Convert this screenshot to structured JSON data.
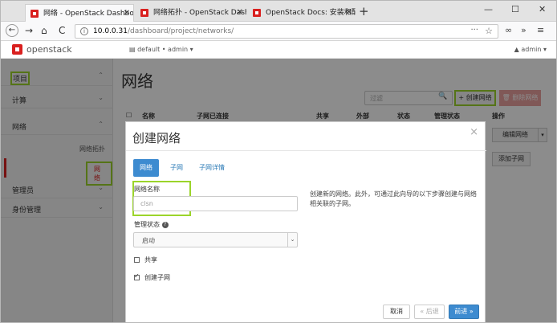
{
  "browser": {
    "tabs": [
      {
        "title": "网络 - OpenStack Dashboard",
        "active": true
      },
      {
        "title": "网络拓扑 - OpenStack Dashb",
        "active": false
      },
      {
        "title": "OpenStack Docs: 安装和配置",
        "active": false
      }
    ],
    "close_glyph": "✕",
    "new_tab_glyph": "+",
    "window_controls": {
      "minimize": "—",
      "maximize": "☐",
      "close": "✕"
    },
    "nav": {
      "back": "←",
      "forward": "→",
      "home": "⌂",
      "reload": "C"
    },
    "url_host": "10.0.0.31",
    "url_path": "/dashboard/project/networks/",
    "url_dots": "···",
    "bookmark_glyph": "☆",
    "toolbar_right": {
      "ext": "∞",
      "more": "»",
      "menu": "≡"
    }
  },
  "header": {
    "brand": "openstack",
    "project_selector": "▤ default • admin ▾",
    "user_menu": "▲ admin ▾"
  },
  "sidebar": {
    "project": "项目",
    "compute": "计算",
    "network": "网络",
    "network_topology": "网络拓扑",
    "networks": "网络",
    "admin": "管理员",
    "identity": "身份管理",
    "chevron_up": "⌃",
    "chevron_down": "⌄"
  },
  "main": {
    "title": "网络",
    "filter_placeholder": "过滤",
    "filter_icon": "🔍",
    "create_network": "+ 创建网络",
    "delete_network": "🗑 删除网络",
    "columns": [
      "☐",
      "名称",
      "子网已连接",
      "共享",
      "外部",
      "状态",
      "管理状态",
      "操作"
    ],
    "edit_network": "编辑网络",
    "caret": "▾",
    "add_subnet": "添加子网"
  },
  "modal": {
    "title": "创建网络",
    "close": "×",
    "tabs": [
      "网络",
      "子网",
      "子网详情"
    ],
    "network_name_label": "网络名称",
    "network_name_placeholder": "clsn",
    "admin_state_label": "管理状态",
    "admin_state_help": "?",
    "admin_state_value": "启动",
    "select_caret": "⌄",
    "shared_label": "共享",
    "create_subnet_label": "创建子网",
    "help_text": "创建新的网络。此外，可通过此向导的以下步骤创建与网络相关联的子网。",
    "buttons": {
      "cancel": "取消",
      "back": "« 后退",
      "next": "前进 »"
    }
  },
  "colors": {
    "highlight": "#9bd42a",
    "primary": "#3d8bd0",
    "brand_red": "#d9201f"
  }
}
